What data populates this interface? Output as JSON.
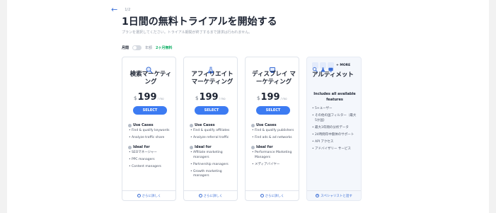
{
  "header": {
    "step": "1/2",
    "title": "1日間の無料トライアルを開始する",
    "subtitle": "プランを選択してください。トライアル期間が終了するまで請求は行われません。"
  },
  "billing": {
    "monthly_label": "月間",
    "yearly_label": "年額",
    "free_months": "2ヶ月無料"
  },
  "plans": [
    {
      "name": "検索マーケティング",
      "currency": "$",
      "price": "199",
      "period": "mo",
      "select_label": "SELECT",
      "use_cases_label": "Use Cases",
      "use_cases": [
        "Find & qualify keywords",
        "Analyze traffic share"
      ],
      "ideal_label": "Ideal for",
      "ideal": [
        "SEOマネージャー",
        "PPC managers",
        "Content managers"
      ],
      "footer_label": "さらに詳しく"
    },
    {
      "name": "アフィリエイトマーケティング",
      "currency": "$",
      "price": "199",
      "period": "mo",
      "select_label": "SELECT",
      "use_cases_label": "Use Cases",
      "use_cases": [
        "Find & qualify affiliates",
        "Analyze referral traffic"
      ],
      "ideal_label": "Ideal for",
      "ideal": [
        "Affiliate marketing managers",
        "Partnership managers",
        "Growth marketing managers"
      ],
      "footer_label": "さらに詳しく"
    },
    {
      "name": "ディスプレイ マーケティング",
      "currency": "$",
      "price": "199",
      "period": "mo",
      "select_label": "SELECT",
      "use_cases_label": "Use Cases",
      "use_cases": [
        "Find & qualify publishers",
        "Find ads & ad networks"
      ],
      "ideal_label": "Ideal for",
      "ideal": [
        "Performance Marketing Managers",
        "メディアバイヤー"
      ],
      "footer_label": "さらに詳しく"
    }
  ],
  "ultimate": {
    "more_label": "+ MORE",
    "name": "アルティメット",
    "includes": "Includes all available features",
    "features": [
      "5+ユーザー",
      "その他の国フィルター（最大5か国）",
      "最大3年間の分析データ",
      "24時間年中無休のサポート",
      "API アクセス",
      "アドバイザリー サービス"
    ],
    "footer_label": "スペシャリストと話す"
  },
  "colors": {
    "accent": "#3c7bf2",
    "free_green": "#17b26a",
    "link": "#3c6fd6"
  }
}
